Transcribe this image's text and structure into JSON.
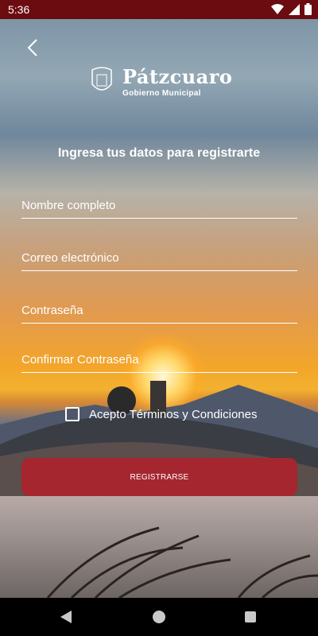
{
  "status_bar": {
    "time": "5:36",
    "icons": [
      "wifi-icon",
      "signal-icon",
      "battery-icon"
    ]
  },
  "brand": {
    "title": "Pátzcuaro",
    "subtitle": "Gobierno Municipal"
  },
  "form": {
    "heading": "Ingresa tus datos para registrarte",
    "fields": [
      {
        "placeholder": "Nombre completo",
        "value": ""
      },
      {
        "placeholder": "Correo electrónico",
        "value": ""
      },
      {
        "placeholder": "Contraseña",
        "value": ""
      },
      {
        "placeholder": "Confirmar Contraseña",
        "value": ""
      }
    ],
    "terms_label": "Acepto Términos y Condiciones",
    "terms_checked": false,
    "submit_label": "REGISTRARSE"
  },
  "colors": {
    "status_bar": "#6b0c10",
    "button": "#a6262f",
    "text": "#ffffff"
  },
  "nav_bar": {
    "icons": [
      "back-triangle-icon",
      "home-circle-icon",
      "recents-square-icon"
    ]
  }
}
